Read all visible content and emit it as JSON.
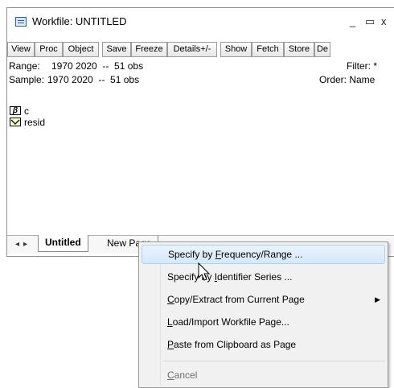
{
  "window": {
    "title": "Workfile: UNTITLED",
    "min_icon": "minimize-icon",
    "close_icon": "close-icon",
    "min_glyph": "_",
    "max_glyph": "▭",
    "close_glyph": "x"
  },
  "toolbar": {
    "buttons": [
      "View",
      "Proc",
      "Object",
      "Save",
      "Freeze",
      "Details+/-",
      "Show",
      "Fetch",
      "Store",
      "De"
    ]
  },
  "info": {
    "range_label": "Range:",
    "range_value": "1970 2020  --  51 obs",
    "sample_label": "Sample:",
    "sample_value": "1970 2020  --  51 obs",
    "filter": "Filter: *",
    "order": "Order: Name"
  },
  "objects": [
    {
      "name": "c",
      "icon": "coefficient-icon"
    },
    {
      "name": "resid",
      "icon": "series-icon"
    }
  ],
  "tabs": {
    "active": "Untitled",
    "new": "New Page"
  },
  "menu": {
    "items": [
      {
        "pre": "Specify by ",
        "u": "F",
        "post": "requency/Range ...",
        "highlight": true,
        "disabled": false
      },
      {
        "pre": "Specify by ",
        "u": "I",
        "post": "dentifier Series ...",
        "highlight": false,
        "disabled": false
      },
      {
        "pre": "",
        "u": "C",
        "post": "opy/Extract from Current Page",
        "highlight": false,
        "disabled": false,
        "submenu": true
      },
      {
        "pre": "",
        "u": "L",
        "post": "oad/Import Workfile Page...",
        "highlight": false,
        "disabled": false
      },
      {
        "pre": "",
        "u": "P",
        "post": "aste from Clipboard as Page",
        "highlight": false,
        "disabled": false
      },
      {
        "pre": "",
        "u": "C",
        "post": "ancel",
        "highlight": false,
        "disabled": true
      }
    ]
  },
  "colors": {
    "menu_highlight": "#d6e8fb",
    "menu_bg": "#f1f1f1"
  }
}
